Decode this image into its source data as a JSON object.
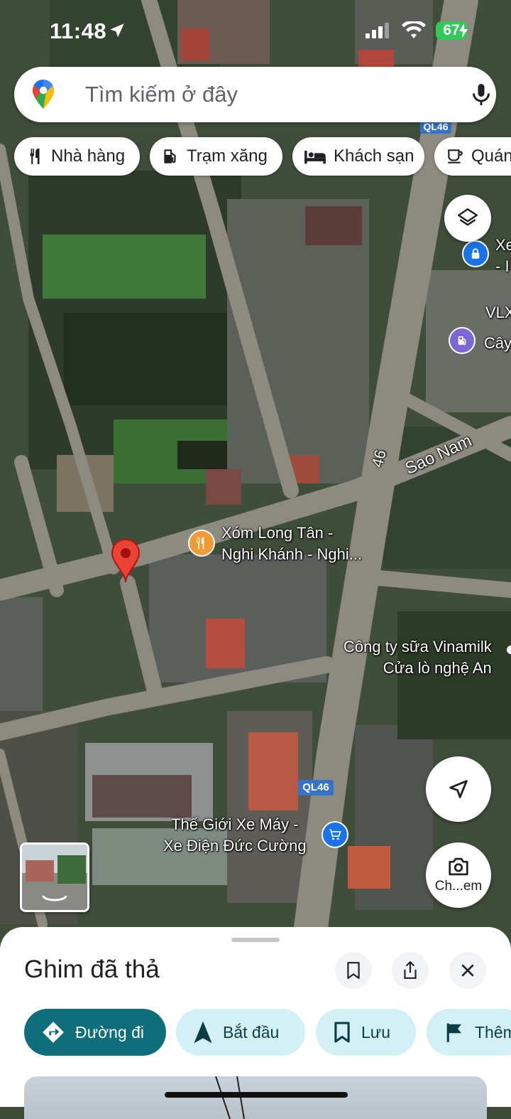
{
  "status_bar": {
    "time": "11:48",
    "battery": "67"
  },
  "search": {
    "placeholder": "Tìm kiếm ở đây"
  },
  "chips": [
    {
      "label": "Nhà hàng",
      "icon": "restaurant-icon"
    },
    {
      "label": "Trạm xăng",
      "icon": "gas-station-icon"
    },
    {
      "label": "Khách sạn",
      "icon": "hotel-icon"
    },
    {
      "label": "Quán",
      "icon": "cafe-icon"
    }
  ],
  "map": {
    "road_labels": {
      "sao_nam": "Sao Nam",
      "route_46": "46",
      "ql46_top": "QL46",
      "ql46_bottom": "QL46"
    },
    "places": {
      "xom_long_tan_line1": "Xóm Long Tân -",
      "xom_long_tan_line2": "Nghi Khánh - Nghi...",
      "vinamilk_line1": "Công ty sữa Vinamilk",
      "vinamilk_line2": "Cửa lò nghệ An",
      "the_gioi_line1": "Thế Giới Xe Máy -",
      "the_gioi_line2": "Xe Điện Đức Cường",
      "edge_xe": "Xe",
      "edge_dash": "- I",
      "edge_vlx": "VLX",
      "edge_cay": "Cây"
    },
    "camera_button_label": "Ch...em"
  },
  "sheet": {
    "title": "Ghim đã thả",
    "actions": [
      {
        "label": "Đường đi",
        "icon": "directions-icon"
      },
      {
        "label": "Bắt đầu",
        "icon": "navigation-arrow-icon"
      },
      {
        "label": "Lưu",
        "icon": "bookmark-icon"
      },
      {
        "label": "Thêm",
        "icon": "flag-icon"
      }
    ]
  },
  "colors": {
    "primary_action": "#0e6e79",
    "secondary_action": "#d3f0f5",
    "pin_red": "#ea4335",
    "battery_green": "#34c759"
  }
}
